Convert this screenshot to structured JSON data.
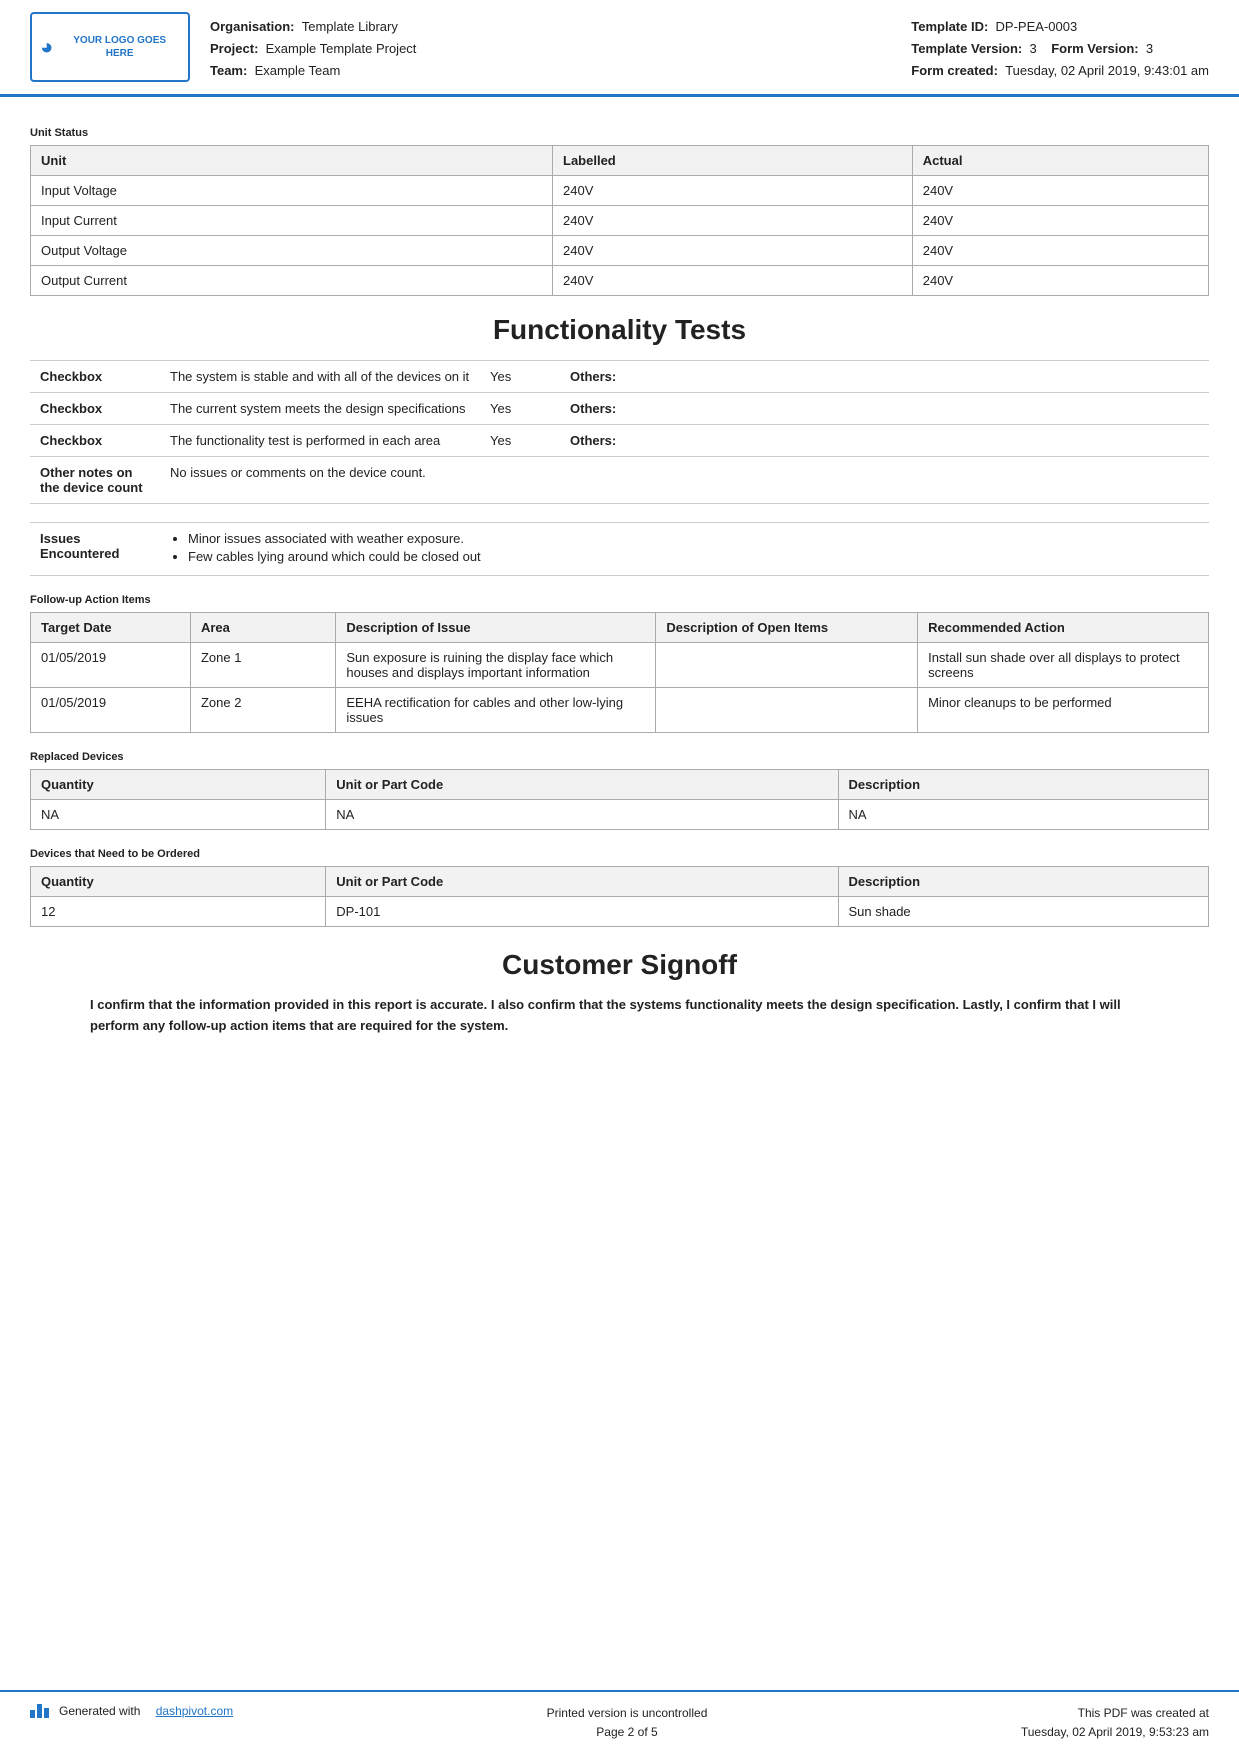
{
  "header": {
    "logo_text": "YOUR LOGO GOES HERE",
    "org_label": "Organisation:",
    "org_value": "Template Library",
    "project_label": "Project:",
    "project_value": "Example Template Project",
    "team_label": "Team:",
    "team_value": "Example Team",
    "template_id_label": "Template ID:",
    "template_id_value": "DP-PEA-0003",
    "template_version_label": "Template Version:",
    "template_version_value": "3",
    "form_version_label": "Form Version:",
    "form_version_value": "3",
    "form_created_label": "Form created:",
    "form_created_value": "Tuesday, 02 April 2019, 9:43:01 am"
  },
  "unit_status": {
    "section_title": "Unit Status",
    "columns": [
      "Unit",
      "Labelled",
      "Actual"
    ],
    "rows": [
      [
        "Input Voltage",
        "240V",
        "240V"
      ],
      [
        "Input Current",
        "240V",
        "240V"
      ],
      [
        "Output Voltage",
        "240V",
        "240V"
      ],
      [
        "Output Current",
        "240V",
        "240V"
      ]
    ]
  },
  "functionality_tests": {
    "heading": "Functionality Tests",
    "rows": [
      {
        "type": "Checkbox",
        "description": "The system is stable and with all of the devices on it",
        "value": "Yes",
        "others_label": "Others:"
      },
      {
        "type": "Checkbox",
        "description": "The current system meets the design specifications",
        "value": "Yes",
        "others_label": "Others:"
      },
      {
        "type": "Checkbox",
        "description": "The functionality test is performed in each area",
        "value": "Yes",
        "others_label": "Others:"
      },
      {
        "type": "Other notes on the device count",
        "description": "No issues or comments on the device count.",
        "value": "",
        "others_label": ""
      }
    ],
    "issues_label": "Issues Encountered",
    "issues": [
      "Minor issues associated with weather exposure.",
      "Few cables lying around which could be closed out"
    ]
  },
  "followup": {
    "section_title": "Follow-up Action Items",
    "columns": [
      "Target Date",
      "Area",
      "Description of Issue",
      "Description of Open Items",
      "Recommended Action"
    ],
    "rows": [
      {
        "date": "01/05/2019",
        "area": "Zone 1",
        "issue": "Sun exposure is ruining the display face which houses and displays important information",
        "open_items": "",
        "recommended": "Install sun shade over all displays to protect screens"
      },
      {
        "date": "01/05/2019",
        "area": "Zone 2",
        "issue": "EEHA rectification for cables and other low-lying issues",
        "open_items": "",
        "recommended": "Minor cleanups to be performed"
      }
    ]
  },
  "replaced_devices": {
    "section_title": "Replaced Devices",
    "columns": [
      "Quantity",
      "Unit or Part Code",
      "Description"
    ],
    "rows": [
      [
        "NA",
        "NA",
        "NA"
      ]
    ]
  },
  "devices_to_order": {
    "section_title": "Devices that Need to be Ordered",
    "columns": [
      "Quantity",
      "Unit or Part Code",
      "Description"
    ],
    "rows": [
      [
        "12",
        "DP-101",
        "Sun shade"
      ]
    ]
  },
  "customer_signoff": {
    "heading": "Customer Signoff",
    "text": "I confirm that the information provided in this report is accurate. I also confirm that the systems functionality meets the design specification. Lastly, I confirm that I will perform any follow-up action items that are required for the system."
  },
  "footer": {
    "generated_label": "Generated with",
    "brand_link": "dashpivot.com",
    "center_line1": "Printed version is uncontrolled",
    "center_line2": "Page 2 of 5",
    "right_line1": "This PDF was created at",
    "right_line2": "Tuesday, 02 April 2019, 9:53:23 am"
  }
}
